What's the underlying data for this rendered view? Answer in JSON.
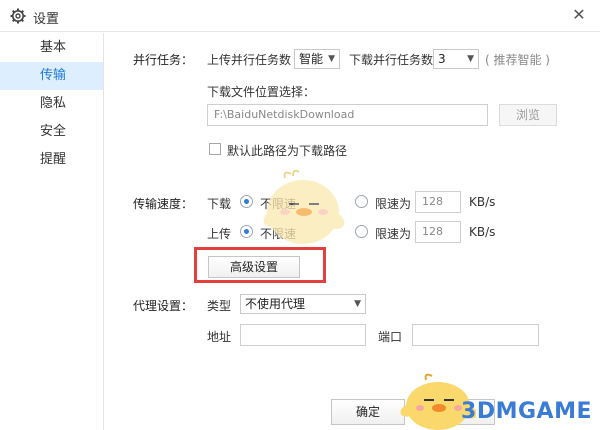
{
  "window": {
    "title": "设置",
    "close_glyph": "✕"
  },
  "sidebar": {
    "items": [
      {
        "label": "基本",
        "active": false
      },
      {
        "label": "传输",
        "active": true
      },
      {
        "label": "隐私",
        "active": false
      },
      {
        "label": "安全",
        "active": false
      },
      {
        "label": "提醒",
        "active": false
      }
    ]
  },
  "parallel": {
    "section_label": "并行任务：",
    "upload_label": "上传并行任务数",
    "upload_value": "智能",
    "download_label": "下载并行任务数",
    "download_value": "3",
    "hint": "( 推荐智能 )"
  },
  "download_location": {
    "label": "下载文件位置选择：",
    "path": "F:\\BaiduNetdiskDownload",
    "browse_label": "浏览",
    "default_checkbox_label": "默认此路径为下载路径",
    "default_checked": false
  },
  "speed": {
    "section_label": "传输速度：",
    "download_label": "下载",
    "upload_label": "上传",
    "unlimited_label": "不限速",
    "limit_label": "限速为",
    "download_limit_value": "128",
    "upload_limit_value": "128",
    "unit": "KB/s",
    "download_mode": "unlimited",
    "upload_mode": "unlimited"
  },
  "advanced": {
    "button_label": "高级设置",
    "highlight_color": "#e43f3f"
  },
  "proxy": {
    "section_label": "代理设置：",
    "type_label": "类型",
    "type_value": "不使用代理",
    "address_label": "地址",
    "address_value": "",
    "port_label": "端口",
    "port_value": ""
  },
  "footer": {
    "ok_label": "确定",
    "cancel_label": "取消"
  },
  "watermark": {
    "text": "3DMGAME"
  },
  "colors": {
    "accent": "#1f7ad8",
    "active_bg": "#ddeeff"
  }
}
